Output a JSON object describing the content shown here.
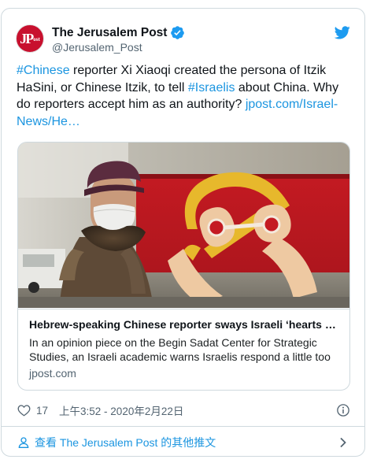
{
  "account": {
    "display_name": "The Jerusalem Post",
    "handle": "@Jerusalem_Post",
    "avatar_text": "JPost"
  },
  "tweet": {
    "hashtag_1": "#Chinese",
    "text_1": " reporter Xi Xiaoqi created the persona of Itzik HaSini, or Chinese Itzik, to tell ",
    "hashtag_2": "#Israelis",
    "text_2": " about China. Why do reporters accept him as an authority? ",
    "link": "jpost.com/Israel-News/He…"
  },
  "card": {
    "title": "Hebrew-speaking Chinese reporter sways Israeli ‘hearts and minds’",
    "description": "In an opinion piece on the Begin Sadat Center for Strategic Studies, an Israeli academic warns Israelis respond a little too",
    "domain": "jpost.com"
  },
  "meta": {
    "likes": "17",
    "timestamp": "上午3:52 - 2020年2月22日"
  },
  "footer": {
    "more_tweets": "查看 The Jerusalem Post 的其他推文"
  },
  "colors": {
    "link": "#1b95e0",
    "verified": "#1d9bf0",
    "brand_red": "#c8102e"
  },
  "icons": [
    "verified-badge-icon",
    "twitter-bird-icon",
    "heart-icon",
    "info-icon",
    "person-icon",
    "chevron-right-icon"
  ]
}
